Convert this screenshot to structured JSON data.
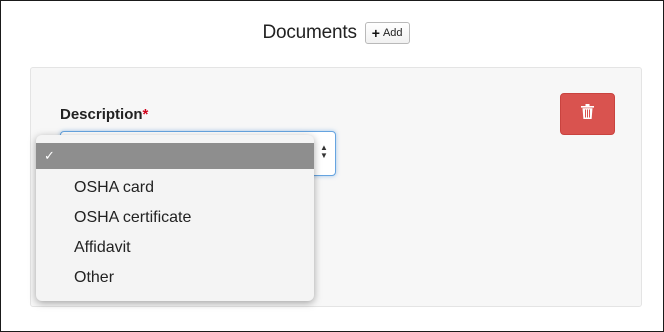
{
  "header": {
    "title": "Documents",
    "add_label": "Add"
  },
  "form": {
    "description_label": "Description",
    "required_marker": "*"
  },
  "icons": {
    "add": "plus-icon",
    "delete": "trash-icon",
    "select": "chevron-up-down-icon",
    "selected": "check-icon"
  },
  "colors": {
    "delete_button": "#d9534f",
    "required": "#d0021b",
    "focus_border": "#66a4e0",
    "selected_option": "#8e8e8e"
  },
  "dropdown": {
    "selected_value": "",
    "check": "✓",
    "options": [
      "",
      "OSHA card",
      "OSHA certificate",
      "Affidavit",
      "Other"
    ]
  }
}
